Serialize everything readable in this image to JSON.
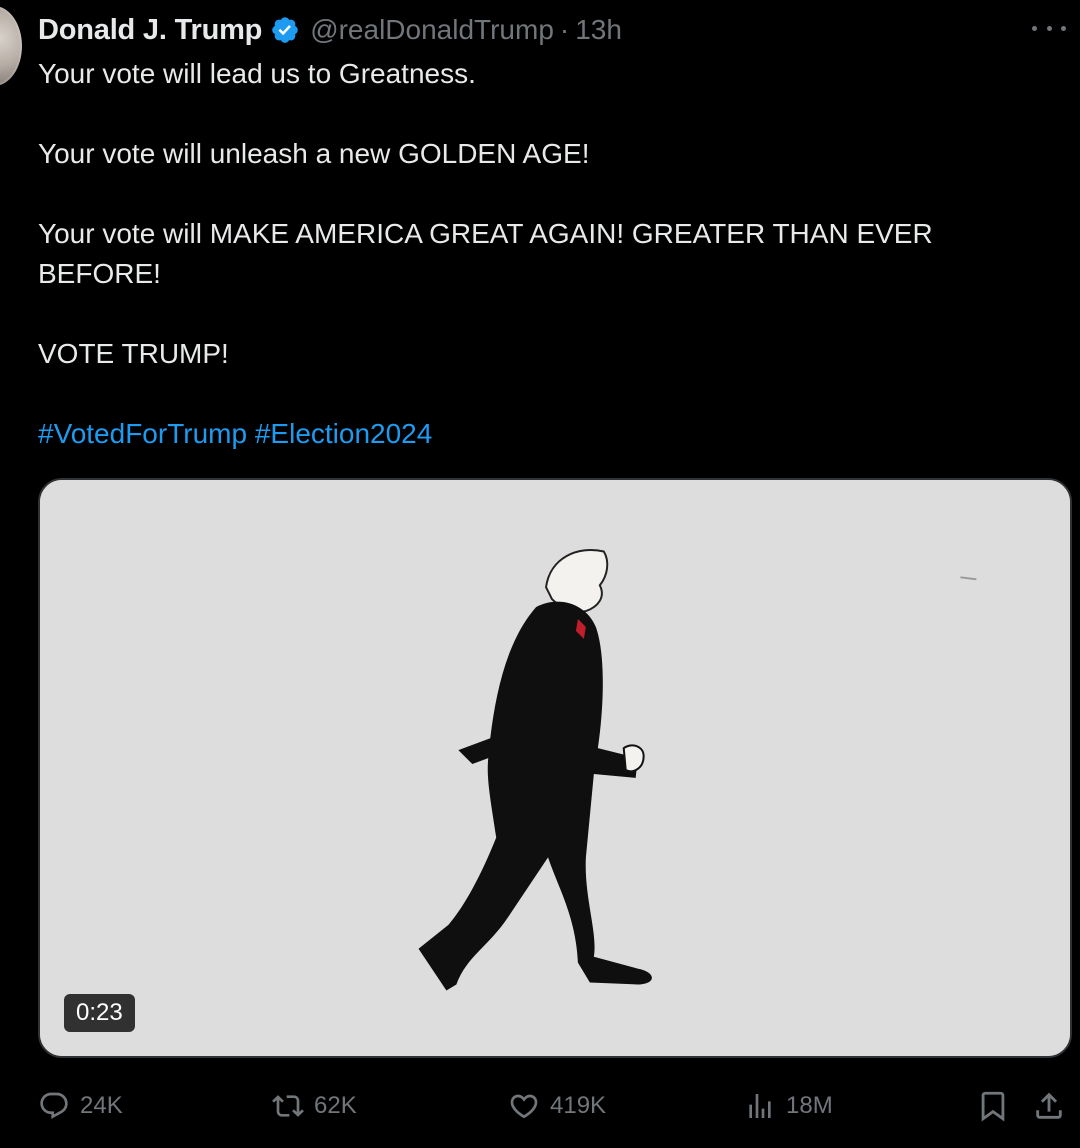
{
  "author": {
    "display_name": "Donald J. Trump",
    "handle": "@realDonaldTrump",
    "separator": "·",
    "time": "13h",
    "verified_color": "#1d9bf0"
  },
  "tweet": {
    "lines": [
      "Your vote will lead us to Greatness.",
      "Your vote will unleash a new GOLDEN AGE!",
      "Your vote will MAKE AMERICA GREAT AGAIN! GREATER THAN EVER BEFORE!",
      "VOTE TRUMP!"
    ],
    "hashtags": [
      "#VotedForTrump",
      "#Election2024"
    ]
  },
  "media": {
    "type": "video",
    "duration": "0:23",
    "background_color": "#dcdcdc"
  },
  "actions": {
    "reply_count": "24K",
    "repost_count": "62K",
    "like_count": "419K",
    "views_count": "18M"
  },
  "icons": {
    "reply": "reply-icon",
    "repost": "repost-icon",
    "like": "like-icon",
    "views": "views-icon",
    "bookmark": "bookmark-icon",
    "share": "share-icon",
    "more": "more-icon",
    "verified": "verified-badge-icon"
  },
  "colors": {
    "background": "#000000",
    "text": "#e7e9ea",
    "muted": "#71767b",
    "link": "#1d9bf0"
  }
}
